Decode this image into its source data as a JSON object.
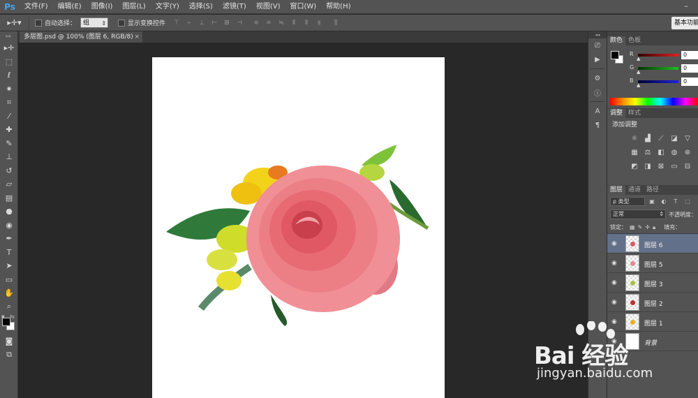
{
  "app": {
    "logo": "Ps",
    "menu": [
      "文件(F)",
      "编辑(E)",
      "图像(I)",
      "图层(L)",
      "文字(Y)",
      "选择(S)",
      "滤镜(T)",
      "视图(V)",
      "窗口(W)",
      "帮助(H)"
    ]
  },
  "options": {
    "auto_select_label": "自动选择：",
    "auto_select_value": "组",
    "show_transform_label": "显示变换控件",
    "workspace_label": "基本功能"
  },
  "document": {
    "tab_title": "多层图.psd @ 100% (图层 6, RGB/8)",
    "close_glyph": "×"
  },
  "color_panel": {
    "tabs": [
      "颜色",
      "色板"
    ],
    "channels": [
      {
        "label": "R",
        "value": "0",
        "color": "#e02020"
      },
      {
        "label": "G",
        "value": "0",
        "color": "#20c020"
      },
      {
        "label": "B",
        "value": "0",
        "color": "#2020e0"
      }
    ]
  },
  "adjust_panel": {
    "tabs": [
      "调整",
      "样式"
    ],
    "title": "添加调整"
  },
  "layers_panel": {
    "tabs": [
      "图层",
      "通道",
      "路径"
    ],
    "kind_label": "ρ 类型",
    "blend_mode": "正常",
    "opacity_label": "不透明度：",
    "lock_label": "锁定：",
    "fill_label": "填充：",
    "layers": [
      {
        "name": "图层 6",
        "selected": true,
        "thumb_color": "#e05a6a"
      },
      {
        "name": "图层 5",
        "selected": false,
        "thumb_color": "#e08a95"
      },
      {
        "name": "图层 3",
        "selected": false,
        "thumb_color": "#a8c040"
      },
      {
        "name": "图层 2",
        "selected": false,
        "thumb_color": "#c03030"
      },
      {
        "name": "图层 1",
        "selected": false,
        "thumb_color": "#e8b020"
      },
      {
        "name": "背景",
        "selected": false,
        "background": true
      }
    ]
  },
  "watermark": {
    "main": "Bai 经验",
    "sub": "jingyan.baidu.com"
  },
  "colors": {
    "ps_blue": "#4aa3e6",
    "selected_layer": "#637089",
    "foreground": "#000000",
    "background": "#ffffff"
  }
}
